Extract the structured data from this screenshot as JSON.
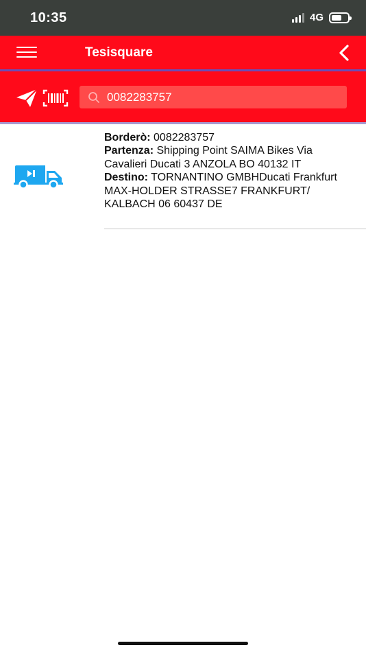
{
  "status_bar": {
    "time": "10:35",
    "network": "4G",
    "battery_level": 0.62
  },
  "app_bar": {
    "title": "Tesisquare",
    "menu_icon": "hamburger-menu-icon",
    "back_icon": "chevron-left-icon"
  },
  "search_bar": {
    "send_icon": "paper-plane-icon",
    "barcode_icon": "barcode-scan-icon",
    "search_icon": "search-icon",
    "value": "0082283757"
  },
  "shipment": {
    "icon": "delivery-truck-icon",
    "bordero_label": "Borderò:",
    "bordero_value": "0082283757",
    "partenza_label": "Partenza:",
    "partenza_value": "Shipping Point SAIMA Bikes Via Cavalieri Ducati 3 ANZOLA BO 40132 IT",
    "destino_label": "Destino:",
    "destino_value": "TORNANTINO GMBHDucati Frankfurt MAX-HOLDER STRASSE7 FRANKFURT/ KALBACH 06 60437 DE"
  },
  "colors": {
    "brand_red": "#ff0a1a",
    "status_bar": "#3a3f3b",
    "truck_blue": "#1ea7f0"
  }
}
